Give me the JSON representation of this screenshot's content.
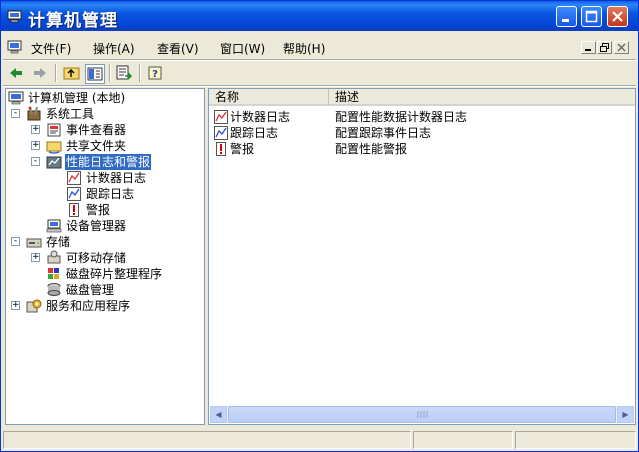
{
  "window": {
    "title": "计算机管理",
    "colors": {
      "titlebar": "#0a56e1",
      "selection": "#316ac5",
      "chrome": "#ece9d8"
    }
  },
  "menubar": {
    "items": [
      "文件(F)",
      "操作(A)",
      "查看(V)",
      "窗口(W)",
      "帮助(H)"
    ]
  },
  "toolbar": {
    "icons": [
      "back-arrow-icon",
      "forward-arrow-icon",
      "up-folder-icon",
      "show-hide-tree-icon",
      "export-list-icon",
      "help-icon"
    ]
  },
  "tree": {
    "root": "计算机管理 (本地)",
    "system_tools": "系统工具",
    "event_viewer": "事件查看器",
    "shared_folders": "共享文件夹",
    "perf_logs": "性能日志和警报",
    "counter_logs": "计数器日志",
    "trace_logs": "跟踪日志",
    "alerts": "警报",
    "device_manager": "设备管理器",
    "storage": "存储",
    "removable_storage": "可移动存储",
    "defrag": "磁盘碎片整理程序",
    "disk_mgmt": "磁盘管理",
    "services_apps": "服务和应用程序"
  },
  "list": {
    "columns": [
      "名称",
      "描述"
    ],
    "rows": [
      {
        "name": "计数器日志",
        "desc": "配置性能数据计数器日志",
        "icon": "counter-log-icon"
      },
      {
        "name": "跟踪日志",
        "desc": "配置跟踪事件日志",
        "icon": "trace-log-icon"
      },
      {
        "name": "警报",
        "desc": "配置性能警报",
        "icon": "alert-icon"
      }
    ]
  }
}
